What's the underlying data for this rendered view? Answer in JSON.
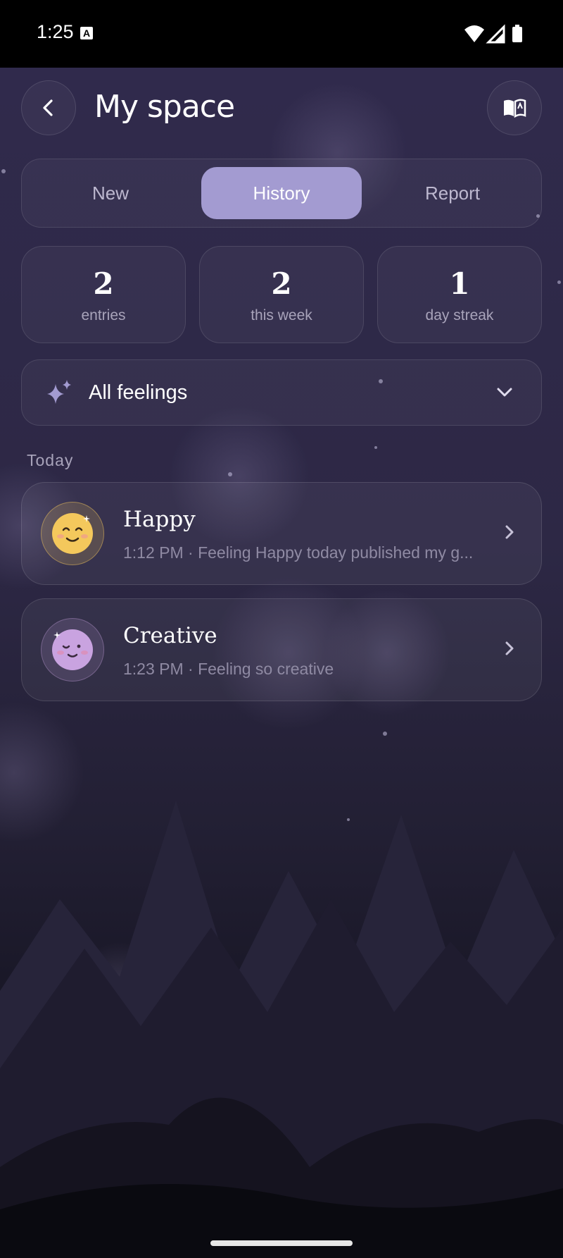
{
  "status": {
    "time": "1:25",
    "a_badge": "A"
  },
  "header": {
    "title": "My space"
  },
  "tabs": [
    {
      "label": "New",
      "active": false
    },
    {
      "label": "History",
      "active": true
    },
    {
      "label": "Report",
      "active": false
    }
  ],
  "stats": [
    {
      "value": "2",
      "label": "entries"
    },
    {
      "value": "2",
      "label": "this week"
    },
    {
      "value": "1",
      "label": "day streak"
    }
  ],
  "filter": {
    "label": "All feelings",
    "icon": "sparkle-icon"
  },
  "section": {
    "label": "Today"
  },
  "entries": [
    {
      "mood": "Happy",
      "subtitle": "1:12 PM · Feeling Happy today published my g...",
      "color": "#f4c85c"
    },
    {
      "mood": "Creative",
      "subtitle": "1:23 PM · Feeling so creative",
      "color": "#c9a3e0"
    }
  ],
  "colors": {
    "accent": "#a39bd1",
    "background": "#2d2845"
  }
}
